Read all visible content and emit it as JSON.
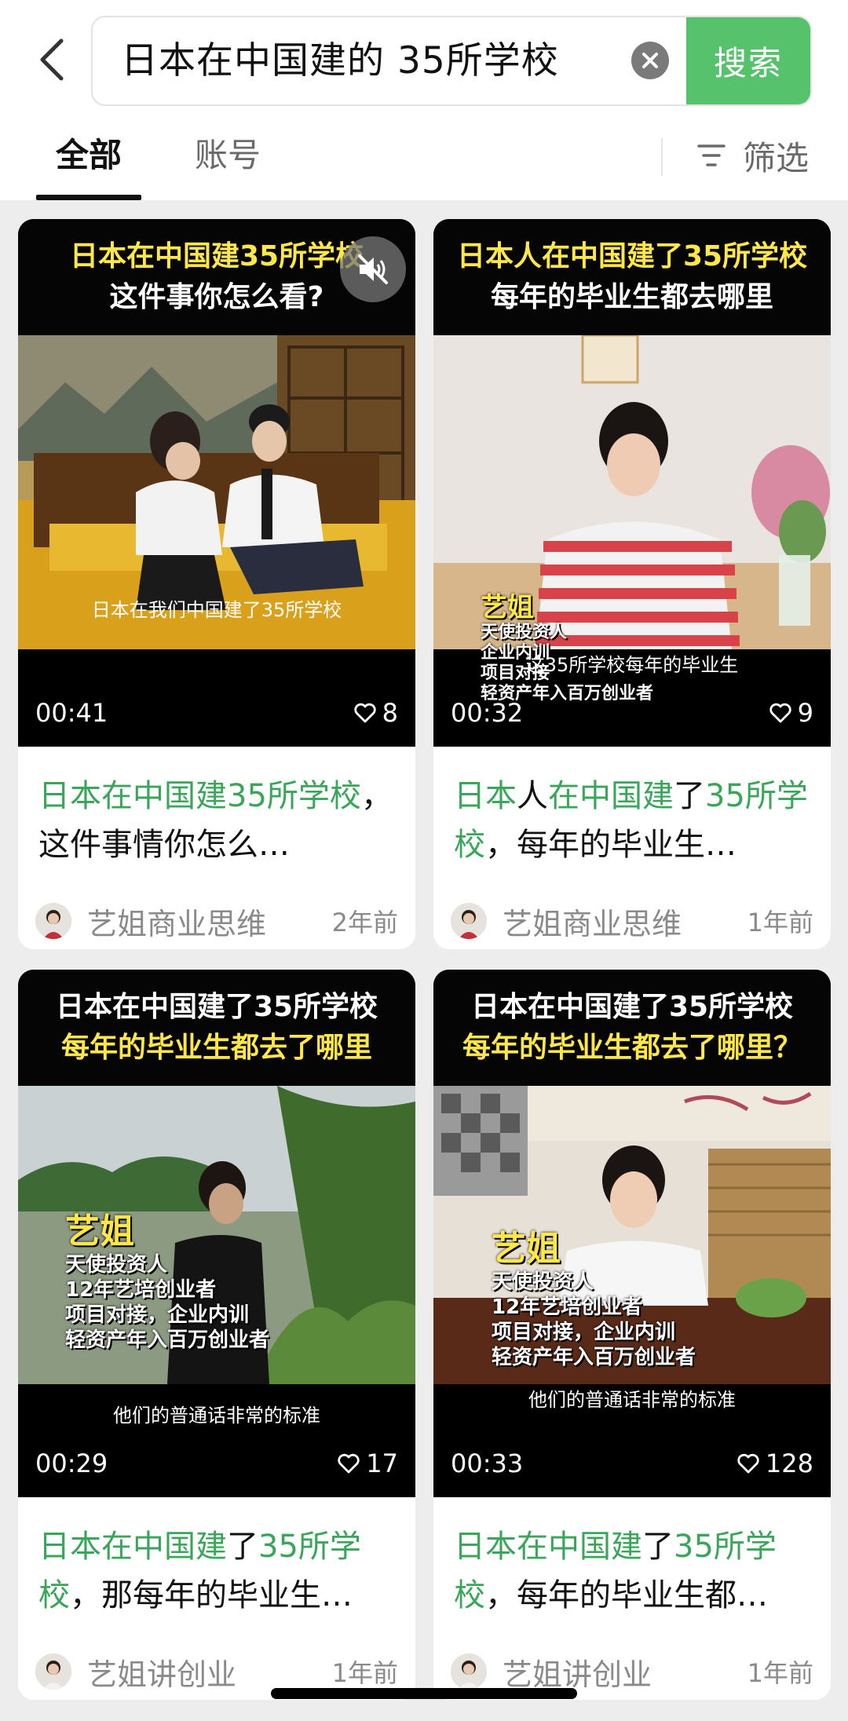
{
  "search": {
    "query": "日本在中国建的 35所学校",
    "button_label": "搜索"
  },
  "tabs": [
    {
      "label": "全部",
      "active": true
    },
    {
      "label": "账号",
      "active": false
    }
  ],
  "filter_label": "筛选",
  "colors": {
    "accent": "#56c26b",
    "highlight_text": "#3aa65a",
    "overlay_yellow": "#ffe74a"
  },
  "videos": [
    {
      "caption_lines": [
        "日本在中国建35所学校",
        "这件事你怎么看?"
      ],
      "subtitle": "日本在我们中国建了35所学校",
      "duration": "00:41",
      "likes": "8",
      "title_parts": [
        {
          "text": "日本在中国建35所学校",
          "hl": true
        },
        {
          "text": "，这件事情你怎么…",
          "hl": false
        }
      ],
      "author": "艺姐商业思维",
      "time": "2年前",
      "muted_icon": "mute-icon"
    },
    {
      "caption_lines": [
        "日本人在中国建了35所学校",
        "每年的毕业生都去哪里"
      ],
      "overlay": [
        "艺姐",
        "天使投资人",
        "企业内训",
        "项目对接",
        "轻资产年入百万创业者"
      ],
      "subtitle": "这35所学校每年的毕业生",
      "duration": "00:32",
      "likes": "9",
      "title_parts": [
        {
          "text": "日本",
          "hl": true
        },
        {
          "text": "人",
          "hl": false
        },
        {
          "text": "在中国建",
          "hl": true
        },
        {
          "text": "了",
          "hl": false
        },
        {
          "text": "35所学校",
          "hl": true
        },
        {
          "text": "，每年的毕业生…",
          "hl": false
        }
      ],
      "author": "艺姐商业思维",
      "time": "1年前"
    },
    {
      "caption_lines": [
        "日本在中国建了35所学校",
        "每年的毕业生都去了哪里"
      ],
      "overlay": [
        "艺姐",
        "天使投资人",
        "12年艺培创业者",
        "项目对接，企业内训",
        "轻资产年入百万创业者"
      ],
      "subtitle": "他们的普通话非常的标准",
      "duration": "00:29",
      "likes": "17",
      "title_parts": [
        {
          "text": "日本在中国建",
          "hl": true
        },
        {
          "text": "了",
          "hl": false
        },
        {
          "text": "35所学校",
          "hl": true
        },
        {
          "text": "，那每年的毕业生…",
          "hl": false
        }
      ],
      "author": "艺姐讲创业",
      "time": "1年前"
    },
    {
      "caption_lines": [
        "日本在中国建了35所学校",
        "每年的毕业生都去了哪里？"
      ],
      "overlay": [
        "艺姐",
        "天使投资人",
        "12年艺培创业者",
        "项目对接，企业内训",
        "轻资产年入百万创业者"
      ],
      "subtitle": "他们的普通话非常的标准",
      "duration": "00:33",
      "likes": "128",
      "title_parts": [
        {
          "text": "日本在中国建",
          "hl": true
        },
        {
          "text": "了",
          "hl": false
        },
        {
          "text": "35所学校",
          "hl": true
        },
        {
          "text": "，每年的毕业生都…",
          "hl": false
        }
      ],
      "author": "艺姐讲创业",
      "time": "1年前"
    }
  ]
}
